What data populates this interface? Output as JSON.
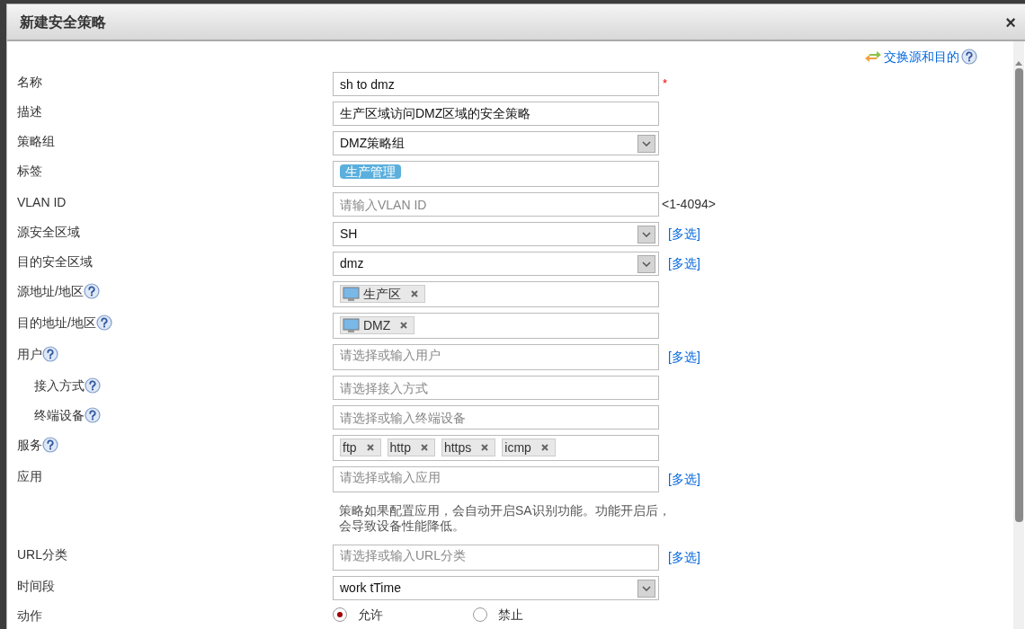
{
  "dialog": {
    "title": "新建安全策略",
    "close": "×",
    "swap_link": "交换源和目的",
    "swap_help": true
  },
  "rows": [
    {
      "label": "名称",
      "help": false,
      "kind": "text",
      "value": "sh to dmz",
      "required_mark": "*"
    },
    {
      "label": "描述",
      "help": false,
      "kind": "text",
      "value": "生产区域访问DMZ区域的安全策略"
    },
    {
      "label": "策略组",
      "help": false,
      "kind": "select",
      "value": "DMZ策略组"
    },
    {
      "label": "标签",
      "help": false,
      "kind": "tags",
      "tags": [
        "生产管理"
      ]
    },
    {
      "label": "VLAN ID",
      "help": false,
      "kind": "text",
      "placeholder": "请输入VLAN ID",
      "hint": "<1-4094>"
    },
    {
      "label": "源安全区域",
      "help": false,
      "kind": "select",
      "value": "SH",
      "multi": "[多选]"
    },
    {
      "label": "目的安全区域",
      "help": false,
      "kind": "select",
      "value": "dmz",
      "multi": "[多选]"
    },
    {
      "label": "源地址/地区",
      "help": true,
      "kind": "chips",
      "chips": [
        {
          "text": "生产区",
          "kind": "address"
        }
      ]
    },
    {
      "label": "目的地址/地区",
      "help": true,
      "kind": "chips",
      "chips": [
        {
          "text": "DMZ",
          "kind": "address"
        }
      ]
    },
    {
      "label": "用户",
      "help": true,
      "kind": "text",
      "placeholder": "请选择或输入用户",
      "multi": "[多选]",
      "children": [
        {
          "label": "接入方式",
          "help": true,
          "kind": "text",
          "placeholder": "请选择接入方式"
        },
        {
          "label": "终端设备",
          "help": true,
          "kind": "text",
          "placeholder": "请选择或输入终端设备"
        }
      ]
    },
    {
      "label": "服务",
      "help": true,
      "kind": "chips",
      "chips": [
        {
          "text": "ftp",
          "kind": "service"
        },
        {
          "text": "http",
          "kind": "service"
        },
        {
          "text": "https",
          "kind": "service"
        },
        {
          "text": "icmp",
          "kind": "service"
        }
      ]
    },
    {
      "label": "应用",
      "help": false,
      "kind": "text",
      "placeholder": "请选择或输入应用",
      "multi": "[多选]",
      "note": "策略如果配置应用，会自动开启SA识别功能。功能开启后，会导致设备性能降低。"
    },
    {
      "label": "URL分类",
      "help": false,
      "kind": "text",
      "placeholder": "请选择或输入URL分类",
      "multi": "[多选]"
    },
    {
      "label": "时间段",
      "help": false,
      "kind": "select",
      "value": "work tTime"
    },
    {
      "label": "动作",
      "help": false,
      "kind": "radio",
      "options": [
        {
          "label": "允许",
          "selected": true
        },
        {
          "label": "禁止",
          "selected": false
        }
      ]
    }
  ]
}
